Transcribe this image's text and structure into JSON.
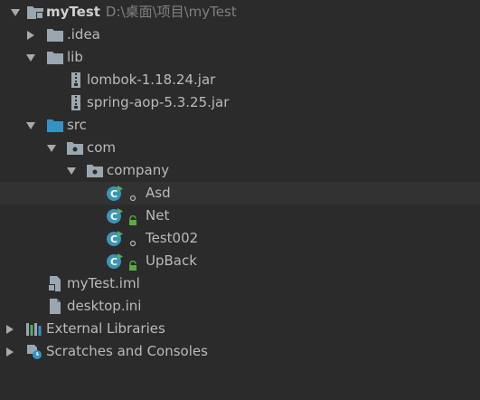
{
  "tree": {
    "project": {
      "name": "myTest",
      "path": "D:\\桌面\\项目\\myTest"
    },
    "idea": {
      "label": ".idea"
    },
    "lib": {
      "label": "lib"
    },
    "lombok": {
      "label": "lombok-1.18.24.jar"
    },
    "spring": {
      "label": "spring-aop-5.3.25.jar"
    },
    "src": {
      "label": "src"
    },
    "com": {
      "label": "com"
    },
    "company": {
      "label": "company"
    },
    "classes": [
      {
        "label": "Asd"
      },
      {
        "label": "Net"
      },
      {
        "label": "Test002"
      },
      {
        "label": "UpBack"
      }
    ],
    "iml": {
      "label": "myTest.iml"
    },
    "desktop": {
      "label": "desktop.ini"
    },
    "external": {
      "label": "External Libraries"
    },
    "scratches": {
      "label": "Scratches and Consoles"
    }
  },
  "icons": {
    "folder": "folder-icon",
    "source_folder": "source-folder-icon",
    "package": "package-icon",
    "class": "java-class-icon",
    "jar": "jar-icon",
    "file": "file-icon",
    "libraries": "libraries-icon",
    "scratches": "scratches-icon"
  },
  "colors": {
    "background": "#2b2b2b",
    "selected_row": "#323232",
    "text": "#bbbbbb",
    "muted_path": "#808080",
    "folder": "#9aa7b0",
    "source_folder": "#3592c4",
    "class_circle": "#3c95b3",
    "run_triangle": "#59a869",
    "lock": "#5fa844"
  }
}
